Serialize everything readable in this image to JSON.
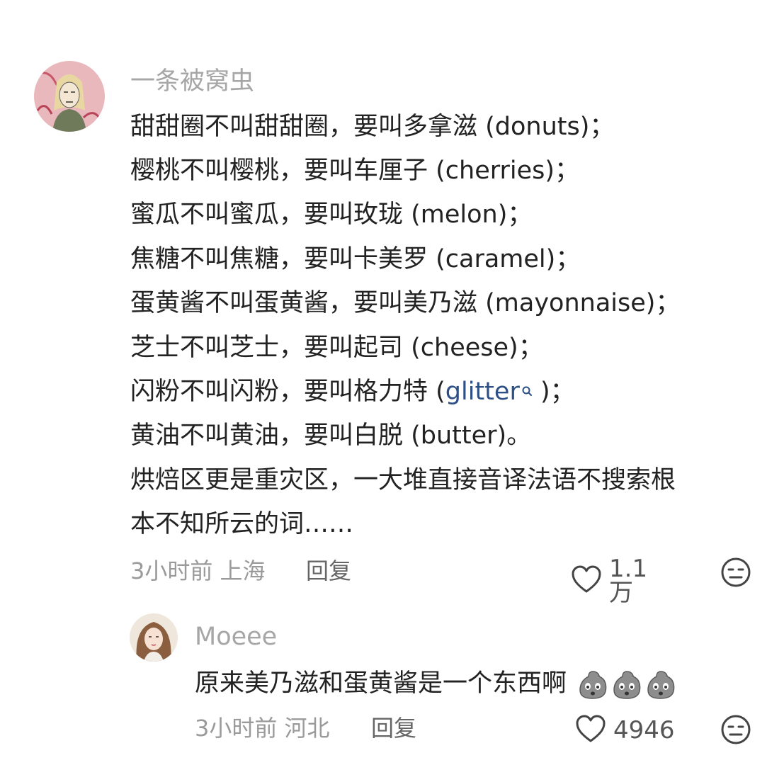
{
  "comments": [
    {
      "username": "一条被窝虫",
      "lines": [
        "甜甜圈不叫甜甜圈，要叫多拿滋 (donuts)；",
        "樱桃不叫樱桃，要叫车厘子 (cherries)；",
        "蜜瓜不叫蜜瓜，要叫玫珑 (melon)；",
        "焦糖不叫焦糖，要叫卡美罗 (caramel)；",
        "蛋黄酱不叫蛋黄酱，要叫美乃滋 (mayonnaise)；",
        "芝士不叫芝士，要叫起司 (cheese)；",
        "闪粉不叫闪粉，要叫格力特 (",
        "黄油不叫黄油，要叫白脱 (butter)。",
        "烘焙区更是重灾区，一大堆直接音译法语不搜索根",
        "本不知所云的词……"
      ],
      "link_text": "glitter",
      "link_suffix": " )；",
      "time": "3小时前 上海",
      "reply_label": "回复",
      "likes": "1.1万"
    },
    {
      "username": "Moeee",
      "text": "原来美乃滋和蛋黄酱是一个东西啊",
      "emoji_count": 3,
      "emoji_icon": "crying-potato-emoji",
      "time": "3小时前 河北",
      "reply_label": "回复",
      "likes": "4946"
    }
  ],
  "colors": {
    "username": "#a6a6a6",
    "link": "#2c4f86",
    "meta": "#9a9a9a"
  }
}
